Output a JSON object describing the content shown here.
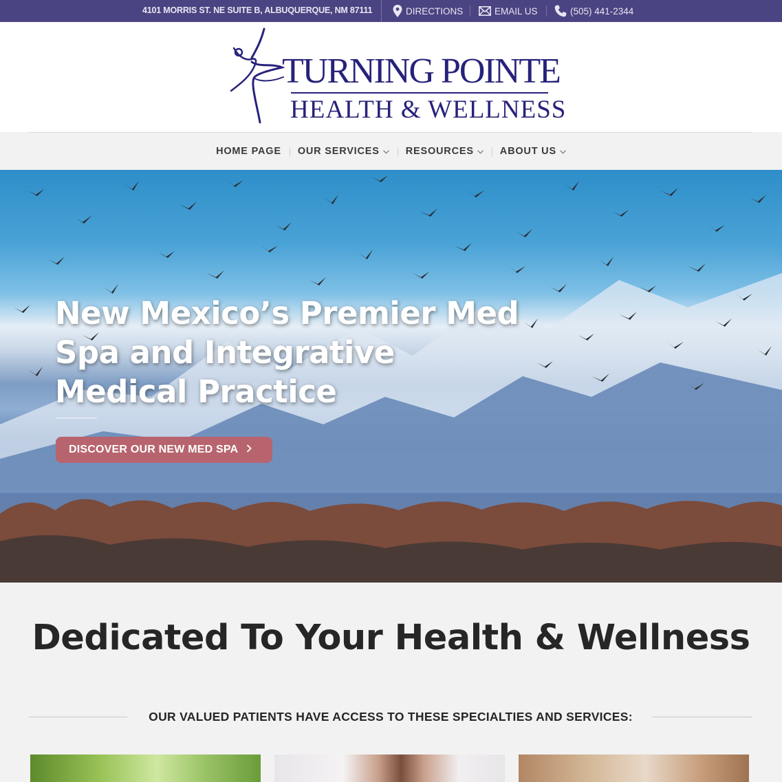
{
  "topbar": {
    "address": "4101 MORRIS ST. NE SUITE B, ALBUQUERQUE, NM 87111",
    "directions": "DIRECTIONS",
    "email": "EMAIL US",
    "phone": "(505) 441-2344",
    "bg_color": "#4b4482"
  },
  "logo": {
    "line1": "TURNING POINTE",
    "line2": "HEALTH & WELLNESS",
    "color": "#27227a"
  },
  "nav": {
    "items": [
      {
        "label": "HOME PAGE",
        "dropdown": false
      },
      {
        "label": "OUR SERVICES",
        "dropdown": true
      },
      {
        "label": "RESOURCES",
        "dropdown": true
      },
      {
        "label": "ABOUT US",
        "dropdown": true
      }
    ]
  },
  "hero": {
    "headline": "New Mexico’s Premier Med Spa and Integrative Medical Practice",
    "cta_label": "DISCOVER OUR NEW MED SPA",
    "cta_color": "#b7646e"
  },
  "main": {
    "heading": "Dedicated To Your Health & Wellness",
    "services_intro": "OUR VALUED PATIENTS HAVE ACCESS TO THESE SPECIALTIES AND SERVICES:"
  }
}
